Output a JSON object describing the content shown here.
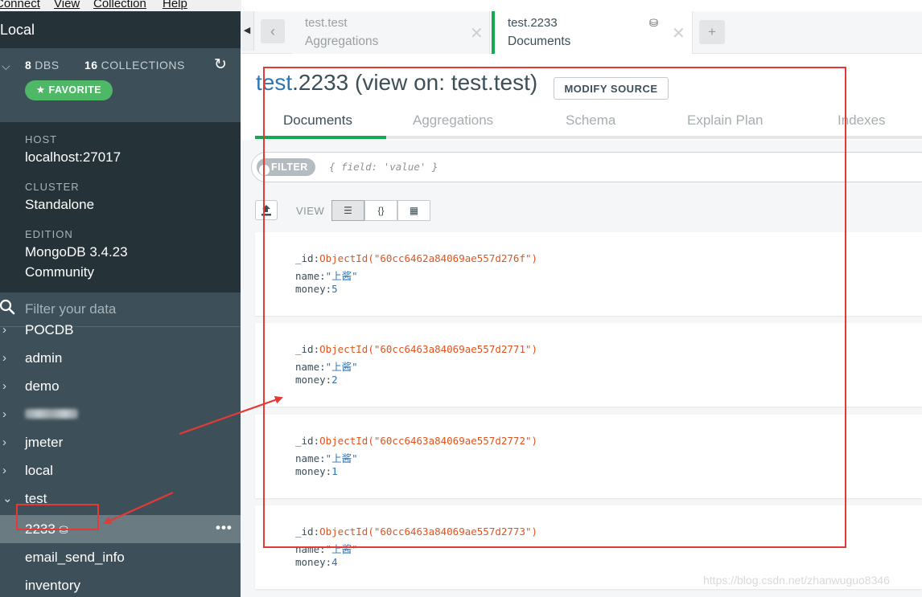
{
  "menubar": {
    "items": [
      "Connect",
      "View",
      "Collection",
      "Help"
    ]
  },
  "sidebar": {
    "title": "Local",
    "dbs_count": "8",
    "dbs_label": "DBS",
    "collections_count": "16",
    "collections_label": "COLLECTIONS",
    "favorite_label": "FAVORITE",
    "host_label": "HOST",
    "host_value": "localhost:27017",
    "cluster_label": "CLUSTER",
    "cluster_value": "Standalone",
    "edition_label": "EDITION",
    "edition_value_line1": "MongoDB 3.4.23",
    "edition_value_line2": "Community",
    "filter_placeholder": "Filter your data",
    "databases": [
      "POCDB",
      "admin",
      "demo",
      "",
      "jmeter",
      "local",
      "test"
    ],
    "collections": [
      "2233",
      "email_send_info",
      "inventory"
    ],
    "active_more": "•••"
  },
  "tabs": {
    "tab1": {
      "title": "test.test",
      "subtitle": "Aggregations"
    },
    "tab2": {
      "title": "test.2233",
      "subtitle": "Documents"
    },
    "add": "+"
  },
  "main": {
    "title_db": "test",
    "title_rest": ".2233 (view on: test.test)",
    "modify_source": "MODIFY SOURCE",
    "subtabs": [
      "Documents",
      "Aggregations",
      "Schema",
      "Explain Plan",
      "Indexes"
    ],
    "filter_label": "FILTER",
    "filter_placeholder": "{ field: 'value' }",
    "view_label": "VIEW",
    "view_buttons": [
      "☰",
      "{}",
      "▦"
    ]
  },
  "documents": [
    {
      "id_key": "_id:",
      "id": "ObjectId(\"60cc6462a84069ae557d276f\")",
      "name_key": "name:",
      "name": "\"上酱\"",
      "money_key": "money:",
      "money": "5"
    },
    {
      "id_key": "_id:",
      "id": "ObjectId(\"60cc6463a84069ae557d2771\")",
      "name_key": "name:",
      "name": "\"上酱\"",
      "money_key": "money:",
      "money": "2"
    },
    {
      "id_key": "_id:",
      "id": "ObjectId(\"60cc6463a84069ae557d2772\")",
      "name_key": "name:",
      "name": "\"上酱\"",
      "money_key": "money:",
      "money": "1"
    },
    {
      "id_key": "_id:",
      "id": "ObjectId(\"60cc6463a84069ae557d2773\")",
      "name_key": "name:",
      "name": "\"上酱\"",
      "money_key": "money:",
      "money": "4"
    }
  ],
  "watermark": "https://blog.csdn.net/zhanwuguo8346",
  "colors": {
    "accent_green": "#13aa52",
    "sidebar_bg": "#3d4f58",
    "sidebar_dark": "#253238",
    "annotation_red": "#e53935"
  }
}
